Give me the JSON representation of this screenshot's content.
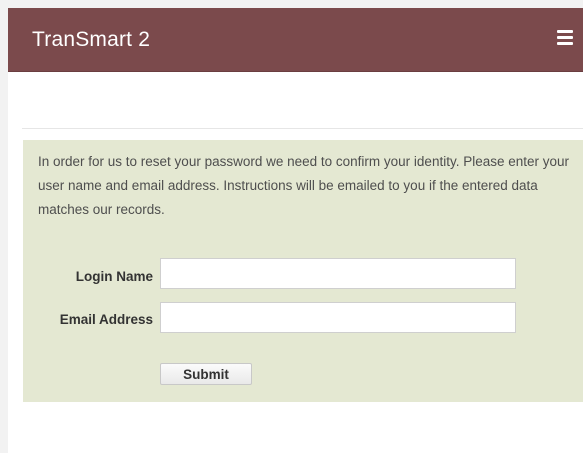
{
  "header": {
    "title": "TranSmart 2",
    "menu_icon": "hamburger-menu-icon",
    "background_color": "#7b4a4c"
  },
  "reset_form": {
    "instructions": "In order for us to reset your password we need to confirm your identity. Please enter your user name and email address. Instructions will be emailed to you if the entered data matches our records.",
    "login_name_label": "Login Name",
    "login_name_value": "",
    "email_label": "Email Address",
    "email_value": "",
    "submit_label": "Submit",
    "panel_color": "#e4e8d2"
  }
}
